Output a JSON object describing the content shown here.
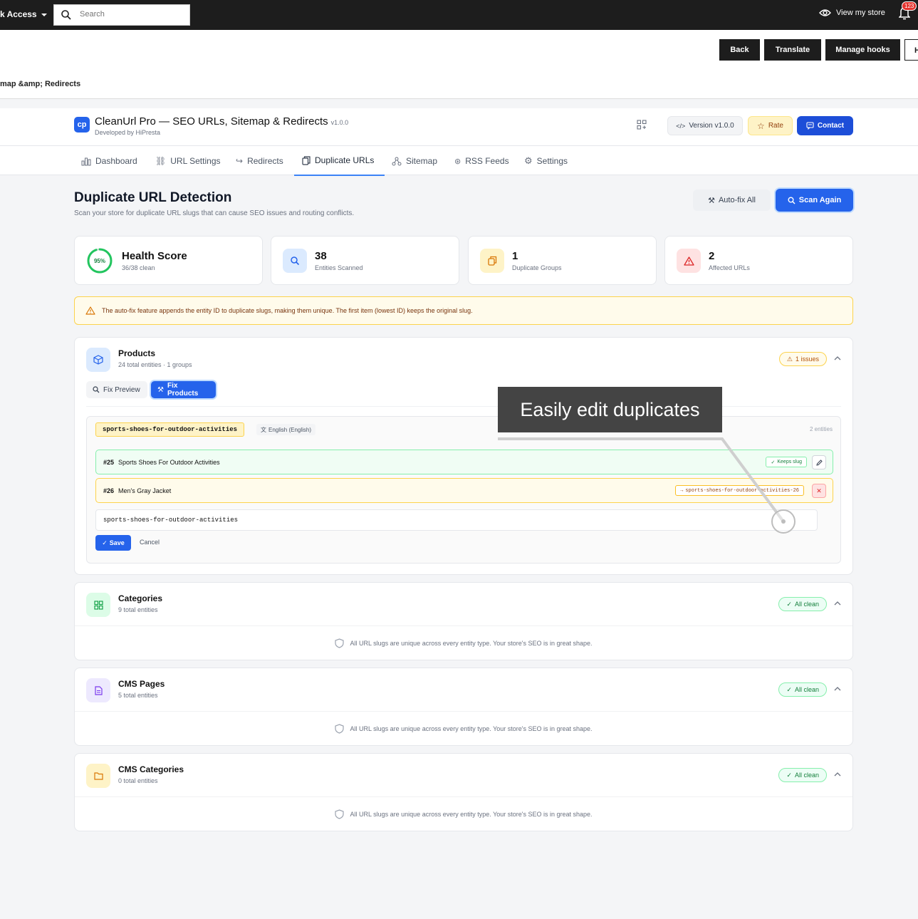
{
  "topbar": {
    "quick_access": "k Access",
    "search_placeholder": "Search",
    "view_store": "View my store",
    "notif_count": "123"
  },
  "toolbar": {
    "buttons": [
      "Back",
      "Translate",
      "Manage hooks",
      "H"
    ],
    "breadcrumb": "map &amp; Redirects"
  },
  "module": {
    "logo": "cp",
    "title": "CleanUrl Pro — SEO URLs, Sitemap & Redirects",
    "version": "v1.0.0",
    "developer": "Developed by HiPresta",
    "version_btn": "Version v1.0.0",
    "rate_btn": "Rate",
    "contact_btn": "Contact",
    "tabs": [
      "Dashboard",
      "URL Settings",
      "Redirects",
      "Duplicate URLs",
      "Sitemap",
      "RSS Feeds",
      "Settings"
    ],
    "active_tab": "Duplicate URLs"
  },
  "page": {
    "title": "Duplicate URL Detection",
    "subtitle": "Scan your store for duplicate URL slugs that can cause SEO issues and routing conflicts.",
    "autofix_btn": "Auto-fix All",
    "scan_btn": "Scan Again"
  },
  "stats": [
    {
      "value": "Health Score",
      "label": "36/38 clean",
      "ring": "95%"
    },
    {
      "value": "38",
      "label": "Entities Scanned"
    },
    {
      "value": "1",
      "label": "Duplicate Groups"
    },
    {
      "value": "2",
      "label": "Affected URLs"
    }
  ],
  "health_fraction": 0.95,
  "alert": "The auto-fix feature appends the entity ID to duplicate slugs, making them unique. The first item (lowest ID) keeps the original slug.",
  "products": {
    "name": "Products",
    "sub": "24 total entities · 1 groups",
    "pill": "1 issues",
    "preview_btn": "Fix Preview",
    "fix_btn": "Fix Products",
    "group": {
      "slug": "sports-shoes-for-outdoor-activities",
      "lang": "English (English)",
      "count": "2 entities",
      "rows": [
        {
          "id": "#25",
          "name": "Sports Shoes For Outdoor Activities",
          "tag": "Keeps slug"
        },
        {
          "id": "#26",
          "name": "Men's Gray Jacket",
          "tag": "sports-shoes-for-outdoor-activities-26"
        }
      ],
      "input_value": "sports-shoes-for-outdoor-activities",
      "save": "Save",
      "cancel": "Cancel"
    }
  },
  "sections": [
    {
      "name": "Categories",
      "sub": "9 total entities",
      "pill": "All clean",
      "msg": "All URL slugs are unique across every entity type. Your store's SEO is in great shape."
    },
    {
      "name": "CMS Pages",
      "sub": "5 total entities",
      "pill": "All clean",
      "msg": "All URL slugs are unique across every entity type. Your store's SEO is in great shape."
    },
    {
      "name": "CMS Categories",
      "sub": "0 total entities",
      "pill": "All clean",
      "msg": "All URL slugs are unique across every entity type. Your store's SEO is in great shape."
    }
  ],
  "callout": "Easily edit duplicates",
  "colors": {
    "accent": "#2563eb",
    "dark": "#1d1d1d",
    "warn": "#fcd34d",
    "ok": "#22c55e",
    "danger": "#ef4444"
  }
}
